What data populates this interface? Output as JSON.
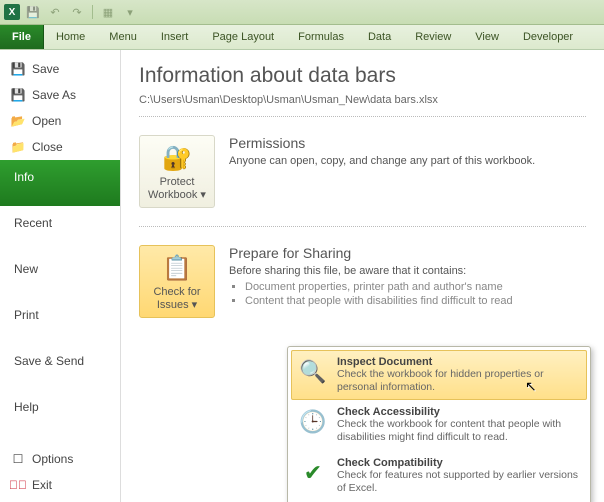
{
  "ribbon": {
    "file": "File",
    "tabs": [
      "Home",
      "Menu",
      "Insert",
      "Page Layout",
      "Formulas",
      "Data",
      "Review",
      "View",
      "Developer"
    ]
  },
  "sidebar": {
    "save": "Save",
    "saveas": "Save As",
    "open": "Open",
    "close": "Close",
    "info": "Info",
    "recent": "Recent",
    "new": "New",
    "print": "Print",
    "savesend": "Save & Send",
    "help": "Help",
    "options": "Options",
    "exit": "Exit"
  },
  "info": {
    "title": "Information about data bars",
    "path": "C:\\Users\\Usman\\Desktop\\Usman\\Usman_New\\data bars.xlsx",
    "permissions": {
      "button": "Protect Workbook",
      "heading": "Permissions",
      "desc": "Anyone can open, copy, and change any part of this workbook."
    },
    "prepare": {
      "button": "Check for Issues",
      "heading": "Prepare for Sharing",
      "desc": "Before sharing this file, be aware that it contains:",
      "items": [
        "Document properties, printer path and author's name",
        "Content that people with disabilities find difficult to read"
      ]
    }
  },
  "popup": {
    "inspect": {
      "title": "Inspect Document",
      "desc": "Check the workbook for hidden properties or personal information."
    },
    "accessibility": {
      "title": "Check Accessibility",
      "desc": "Check the workbook for content that people with disabilities might find difficult to read."
    },
    "compat": {
      "title": "Check Compatibility",
      "desc": "Check for features not supported by earlier versions of Excel."
    }
  }
}
